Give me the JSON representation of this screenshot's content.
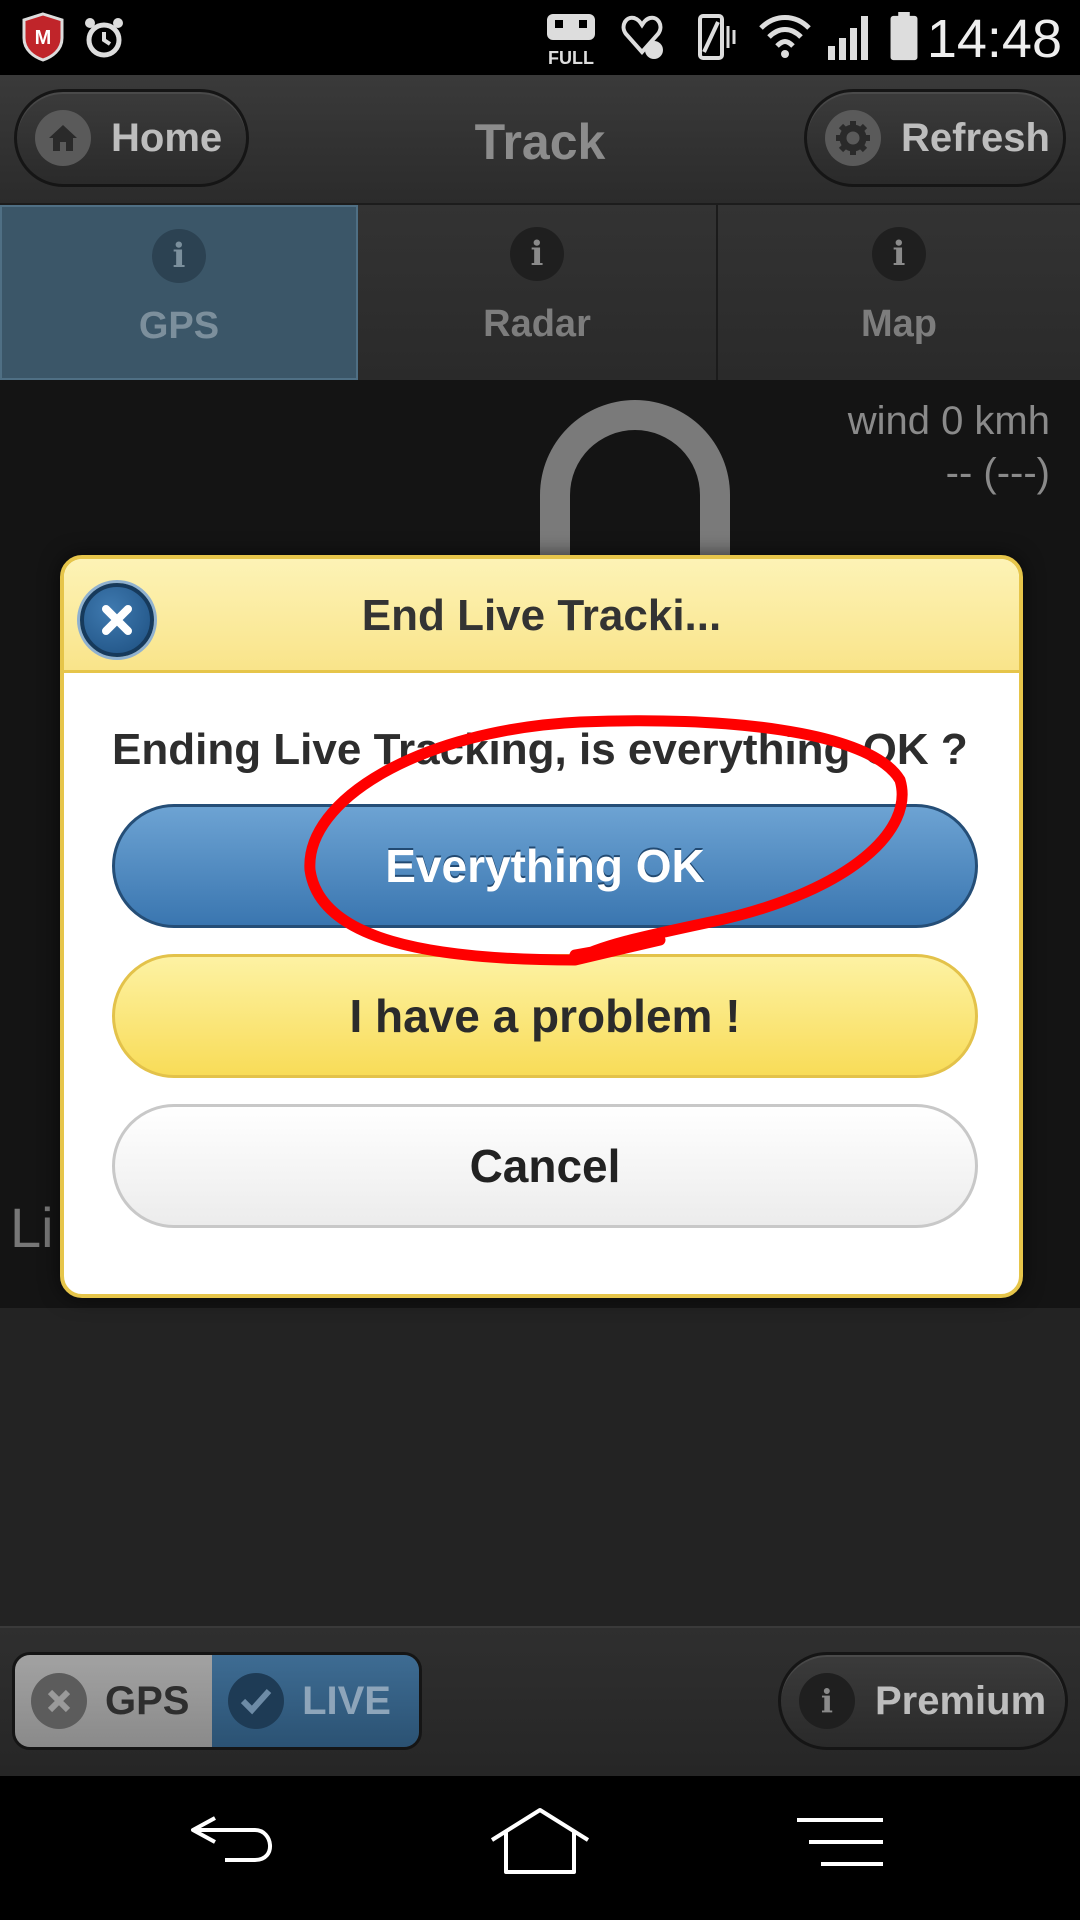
{
  "status_bar": {
    "clock": "14:48",
    "icons": [
      "mcafee-icon",
      "alarm-icon",
      "full-battery-mode-icon",
      "health-icon",
      "vibrate-icon",
      "wifi-icon",
      "signal-icon",
      "battery-icon"
    ],
    "full_label": "FULL"
  },
  "header": {
    "home_label": "Home",
    "title": "Track",
    "refresh_label": "Refresh"
  },
  "tabs": [
    {
      "label": "GPS",
      "active": true
    },
    {
      "label": "Radar",
      "active": false
    },
    {
      "label": "Map",
      "active": false
    }
  ],
  "content": {
    "wind_line1": "wind 0 kmh",
    "wind_line2": "-- (---)",
    "partial_text": "Li"
  },
  "dialog": {
    "title": "End Live Tracki...",
    "message": "Ending Live Tracking, is everything OK ?",
    "buttons": {
      "ok": "Everything OK",
      "problem": "I have a problem !",
      "cancel": "Cancel"
    },
    "annotation_color": "#ff0000"
  },
  "bottom_bar": {
    "gps_label": "GPS",
    "live_label": "LIVE",
    "premium_label": "Premium"
  },
  "colors": {
    "accent_blue": "#3a76b0",
    "dialog_yellow": "#f9e48a",
    "active_tab": "#3b5668"
  }
}
